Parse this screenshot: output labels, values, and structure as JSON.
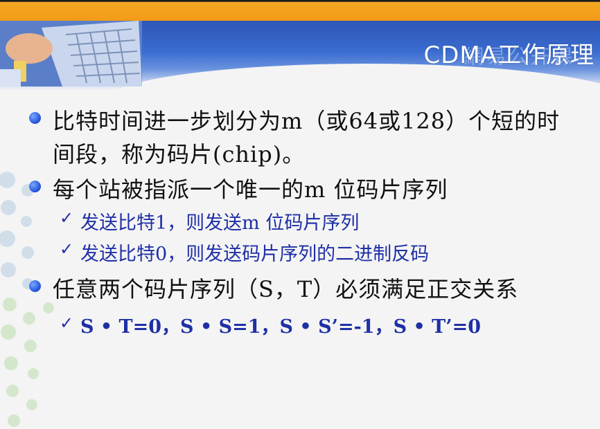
{
  "slide": {
    "title": "CDMA工作原理",
    "watermark": "網易公开课"
  },
  "bullets": [
    {
      "lines": [
        "比特时间进一步划分为m（或64或128）个短的时",
        "间段，称为码片(chip)。"
      ]
    },
    {
      "lines": [
        "每个站被指派一个唯一的m 位码片序列"
      ],
      "sub": [
        "发送比特1，则发送m 位码片序列",
        "发送比特0，则发送码片序列的二进制反码"
      ]
    },
    {
      "lines": [
        "任意两个码片序列（S，T）必须满足正交关系"
      ],
      "sub": [
        "S • T=0，S • S=1，S • S’=-1，S • T’=0"
      ]
    }
  ],
  "icons": {
    "bullet": "bullet-dot-icon",
    "sub": "checkmark-icon"
  },
  "colors": {
    "header_blue": "#2e56b6",
    "top_bar": "#f39b18",
    "sub_text": "#1f2fa6",
    "bullet": "#1e4fd6"
  }
}
